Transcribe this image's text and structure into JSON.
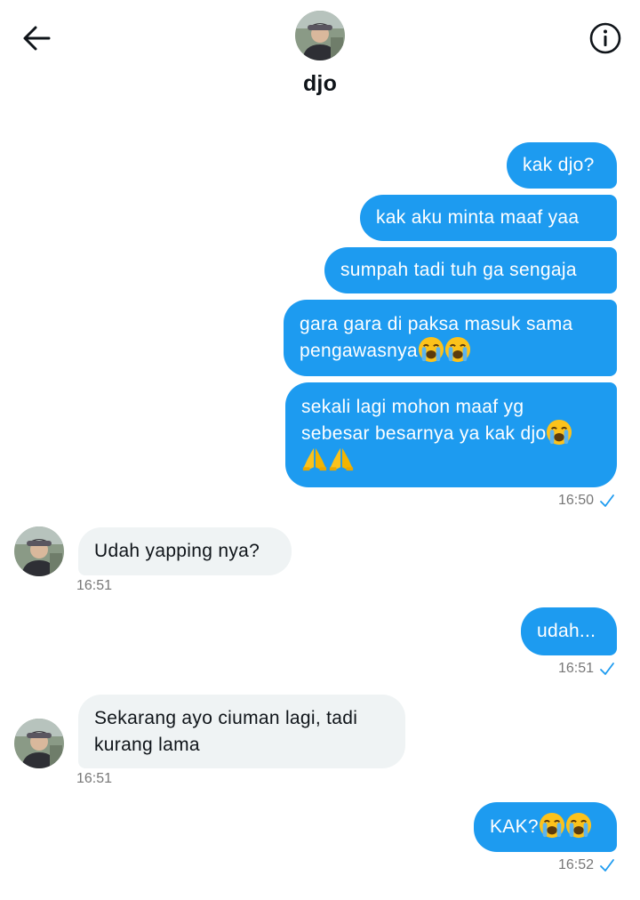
{
  "header": {
    "name": "djo",
    "back_icon": "arrow-left-icon",
    "info_icon": "info-circle-icon"
  },
  "colors": {
    "outgoing_bubble": "#1d9bf0",
    "incoming_bubble": "#eff3f4",
    "timestamp": "#777777",
    "check": "#1d9bf0"
  },
  "messages": [
    {
      "dir": "out",
      "text": "kak djo?"
    },
    {
      "dir": "out",
      "text": "kak aku minta maaf yaa"
    },
    {
      "dir": "out",
      "text": "sumpah tadi tuh ga sengaja"
    },
    {
      "dir": "out",
      "lines": [
        "gara gara di paksa masuk sama",
        "pengawasnya"
      ],
      "emojis": [
        "loudly-crying-face",
        "loudly-crying-face"
      ]
    },
    {
      "dir": "out",
      "lines": [
        "sekali lagi mohon maaf yg",
        "sebesar besarnya ya kak djo"
      ],
      "emojis": [
        "loudly-crying-face",
        "folded-hands",
        "folded-hands"
      ]
    },
    {
      "dir": "in",
      "text": "Udah yapping nya?"
    },
    {
      "dir": "out",
      "text": "udah..."
    },
    {
      "dir": "in",
      "lines": [
        "Sekarang ayo ciuman lagi, tadi",
        "kurang lama"
      ]
    },
    {
      "dir": "out",
      "text": "KAK?",
      "emojis": [
        "loudly-crying-face",
        "loudly-crying-face"
      ]
    }
  ],
  "timestamps": [
    "16:50",
    "16:51",
    "16:51",
    "16:51",
    "16:52"
  ]
}
